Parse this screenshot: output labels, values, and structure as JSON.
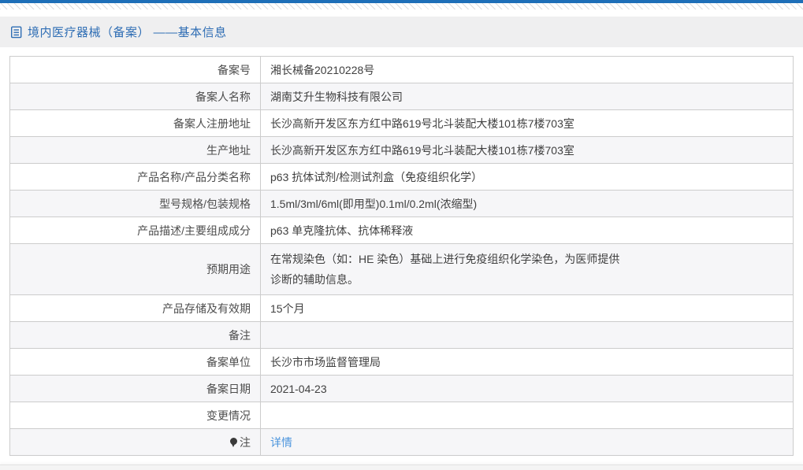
{
  "colors": {
    "accent_bar": "#1e6fb8",
    "header_band": "#efeff0",
    "title_blue": "#2e6db4",
    "link_blue": "#4c95dd",
    "table_border": "#cccccc",
    "stripe_row": "#f6f6f8"
  },
  "header": {
    "title": "境内医疗器械（备案） ——基本信息",
    "icon": "document-icon"
  },
  "table": {
    "rows": [
      {
        "label": "备案号",
        "value": "湘长械备20210228号"
      },
      {
        "label": "备案人名称",
        "value": "湖南艾升生物科技有限公司"
      },
      {
        "label": "备案人注册地址",
        "value": "长沙高新开发区东方红中路619号北斗装配大楼101栋7楼703室"
      },
      {
        "label": "生产地址",
        "value": "长沙高新开发区东方红中路619号北斗装配大楼101栋7楼703室"
      },
      {
        "label": "产品名称/产品分类名称",
        "value": "p63 抗体试剂/检测试剂盒（免疫组织化学）"
      },
      {
        "label": "型号规格/包装规格",
        "value": "1.5ml/3ml/6ml(即用型)0.1ml/0.2ml(浓缩型)"
      },
      {
        "label": "产品描述/主要组成成分",
        "value": "p63 单克隆抗体、抗体稀释液"
      },
      {
        "label": "预期用途",
        "value": "在常规染色（如：HE 染色）基础上进行免疫组织化学染色，为医师提供诊断的辅助信息。",
        "wrap": true
      },
      {
        "label": "产品存储及有效期",
        "value": "15个月"
      },
      {
        "label": "备注",
        "value": ""
      },
      {
        "label": "备案单位",
        "value": "长沙市市场监督管理局"
      },
      {
        "label": "备案日期",
        "value": "2021-04-23"
      },
      {
        "label": "变更情况",
        "value": ""
      },
      {
        "label": "注",
        "value": "详情",
        "link": true,
        "note_icon": true
      }
    ]
  }
}
